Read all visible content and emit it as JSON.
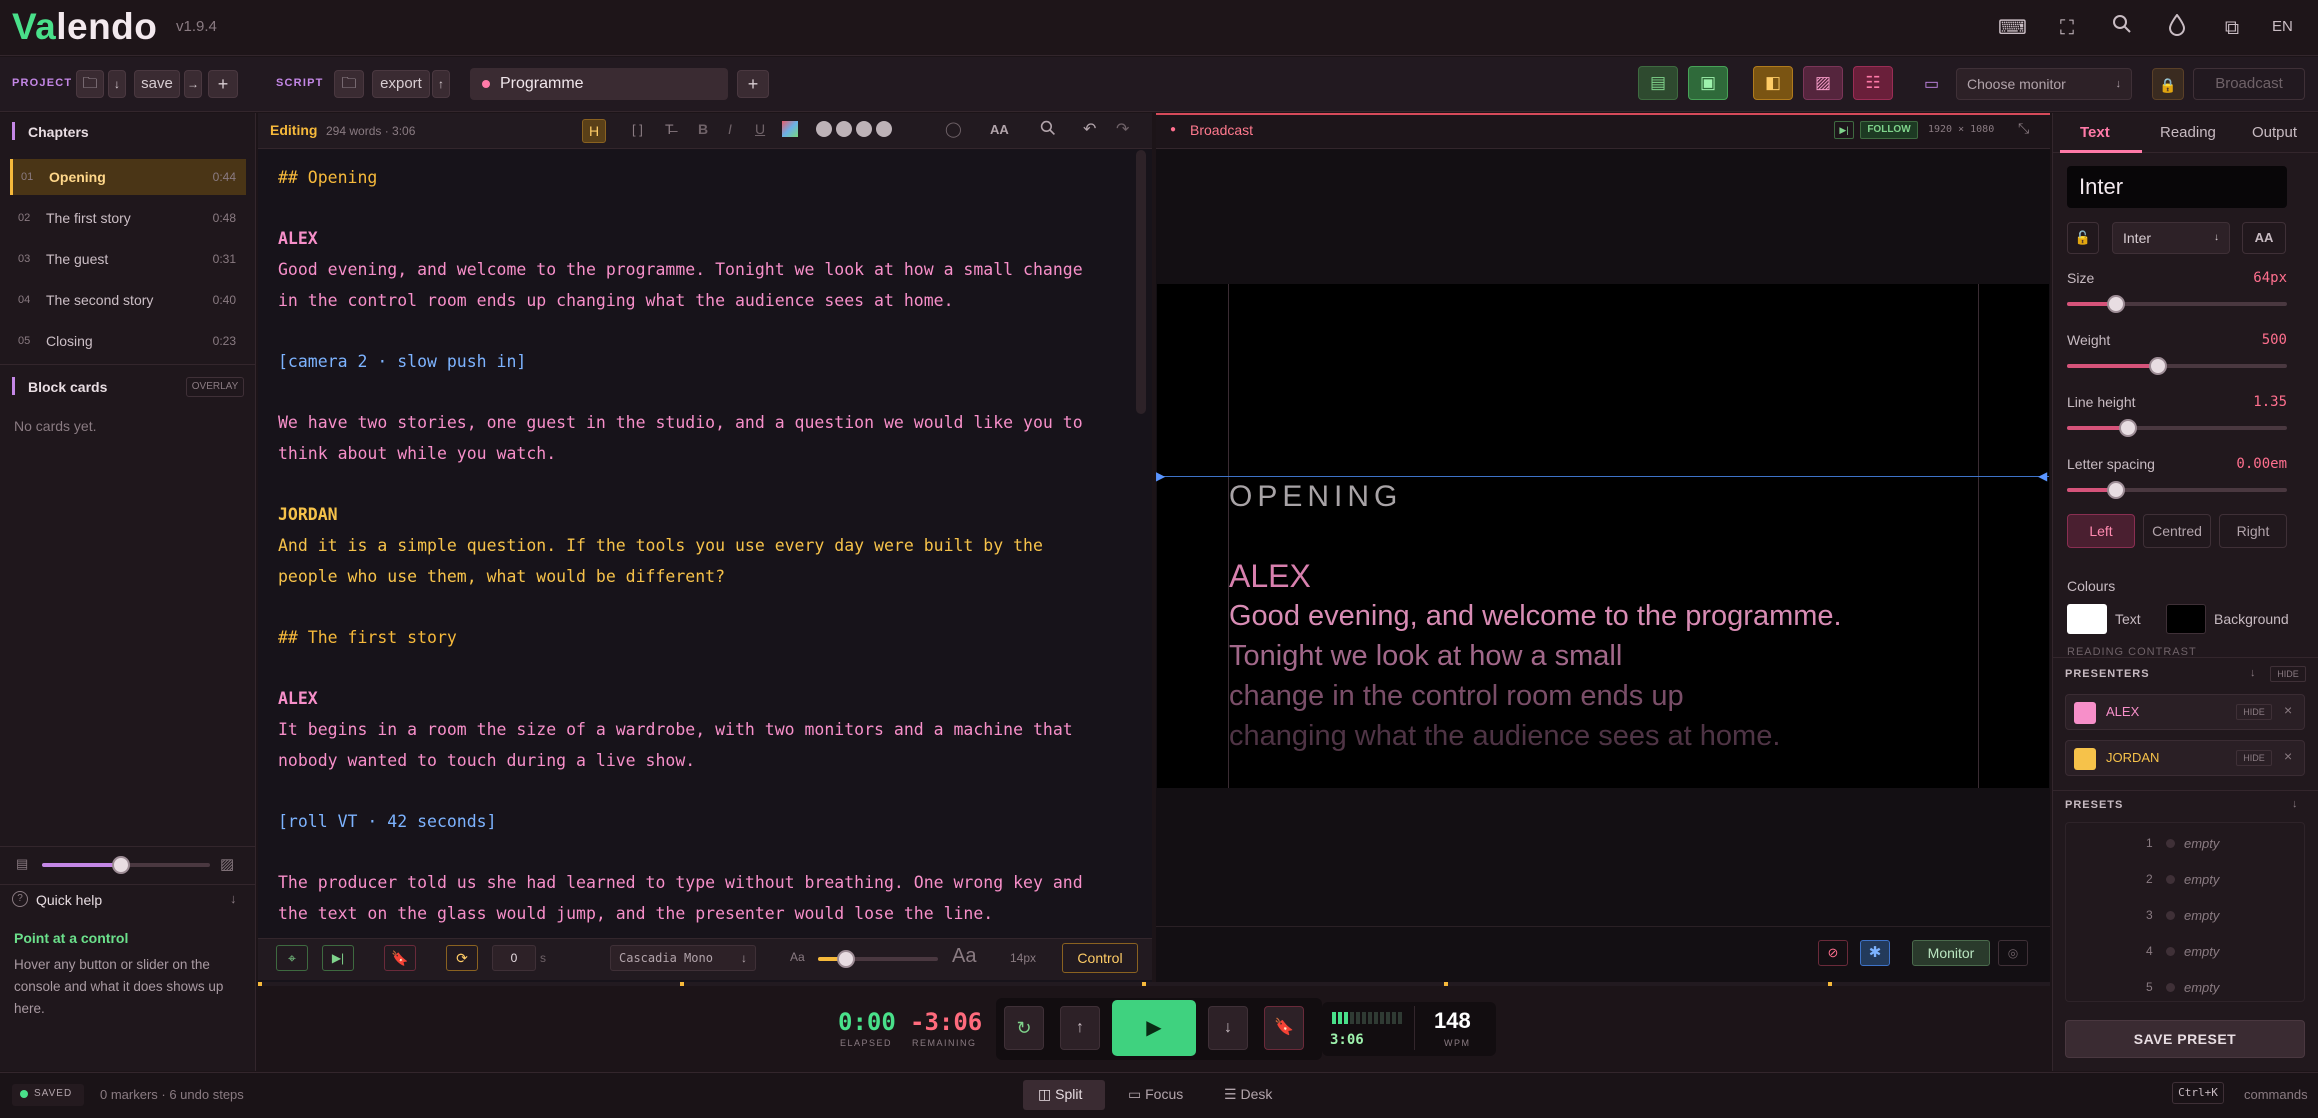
{
  "app": {
    "name_part1": "Va",
    "name_part2": "lendo",
    "version": "v1.9.4",
    "lang": "EN"
  },
  "toolbar": {
    "project_label": "PROJECT",
    "save": "save",
    "script_label": "SCRIPT",
    "export": "export",
    "programme": "Programme",
    "monitor_placeholder": "Choose monitor",
    "broadcast": "Broadcast"
  },
  "chapters": {
    "title": "Chapters",
    "items": [
      {
        "num": "01",
        "name": "Opening",
        "time": "0:44"
      },
      {
        "num": "02",
        "name": "The first story",
        "time": "0:48"
      },
      {
        "num": "03",
        "name": "The guest",
        "time": "0:31"
      },
      {
        "num": "04",
        "name": "The second story",
        "time": "0:40"
      },
      {
        "num": "05",
        "name": "Closing",
        "time": "0:23"
      }
    ]
  },
  "blockcards": {
    "title": "Block cards",
    "badge": "OVERLAY",
    "empty": "No cards yet."
  },
  "quickhelp": {
    "title": "Quick help",
    "heading": "Point at a control",
    "body": "Hover any button or slider on the console and what it does shows up here.",
    "slider_level": 0.47
  },
  "editor": {
    "mode": "Editing",
    "meta": "294 words · 3:06",
    "lines": [
      {
        "t": "## Opening",
        "c": "c-hd"
      },
      {
        "t": "ALEX",
        "c": "c-alex",
        "b": true
      },
      {
        "t": "Good evening, and welcome to the programme. Tonight we look at how a small change",
        "c": "c-alex"
      },
      {
        "t": "in the control room ends up changing what the audience sees at home.",
        "c": "c-alex"
      },
      {
        "t": "[camera 2 · slow push in]",
        "c": "c-cue"
      },
      {
        "t": "We have two stories, one guest in the studio, and a question we would like you to",
        "c": "c-alex"
      },
      {
        "t": "think about while you watch.",
        "c": "c-alex"
      },
      {
        "t": "JORDAN",
        "c": "c-jor",
        "b": true
      },
      {
        "t": "And it is a simple question. If the tools you use every day were built by the",
        "c": "c-jor"
      },
      {
        "t": "people who use them, what would be different?",
        "c": "c-jor"
      },
      {
        "t": "## The first story",
        "c": "c-hd"
      },
      {
        "t": "ALEX",
        "c": "c-alex",
        "b": true
      },
      {
        "t": "It begins in a room the size of a wardrobe, with two monitors and a machine that",
        "c": "c-alex"
      },
      {
        "t": "nobody wanted to touch during a live show.",
        "c": "c-alex"
      },
      {
        "t": "[roll VT · 42 seconds]",
        "c": "c-cue"
      },
      {
        "t": "The producer told us she had learned to type without breathing. One wrong key and",
        "c": "c-alex"
      },
      {
        "t": "the text on the glass would jump, and the presenter would lose the line.",
        "c": "c-alex"
      }
    ],
    "footer": {
      "offset": "0",
      "unit": "s",
      "font": "Cascadia Mono",
      "aa_small": "Aa",
      "aa_big": "Aa",
      "size": "14px",
      "control": "Control",
      "size_level": 0.23
    }
  },
  "broadcast": {
    "title": "Broadcast",
    "follow": "FOLLOW",
    "res": "1920 × 1080",
    "heading": "OPENING",
    "speaker": "ALEX",
    "lines": [
      "Good evening, and welcome to the programme.",
      "Tonight we look at how a small",
      "change in the control room ends up",
      "changing what the audience sees at home."
    ],
    "monitor": "Monitor"
  },
  "right": {
    "tabs": [
      "Text",
      "Reading",
      "Output"
    ],
    "font_display": "Inter",
    "font_select": "Inter",
    "aa": "AA",
    "size_label": "Size",
    "size_val": "64px",
    "weight_label": "Weight",
    "weight_val": "500",
    "lh_label": "Line height",
    "lh_val": "1.35",
    "ls_label": "Letter spacing",
    "ls_val": "0.00em",
    "align": [
      "Left",
      "Centred",
      "Right"
    ],
    "colours_label": "Colours",
    "text_label": "Text",
    "bg_label": "Background",
    "contrast": "READING CONTRAST",
    "presenters_label": "PRESENTERS",
    "hide": "HIDE",
    "presenters": [
      {
        "name": "ALEX",
        "color": "#f78fc9"
      },
      {
        "name": "JORDAN",
        "color": "#f6c24a"
      }
    ],
    "presets_label": "PRESETS",
    "presets": [
      {
        "n": "1",
        "v": "empty"
      },
      {
        "n": "2",
        "v": "empty"
      },
      {
        "n": "3",
        "v": "empty"
      },
      {
        "n": "4",
        "v": "empty"
      },
      {
        "n": "5",
        "v": "empty"
      }
    ],
    "save_preset": "SAVE PRESET"
  },
  "transport": {
    "elapsed": "0:00",
    "elapsed_label": "ELAPSED",
    "remaining": "-3:06",
    "remaining_label": "REMAINING",
    "time": "3:06",
    "wpm": "148",
    "wpm_label": "WPM"
  },
  "status": {
    "saved": "SAVED",
    "info": "0 markers · 6 undo steps",
    "views": [
      "Split",
      "Focus",
      "Desk"
    ],
    "shortcut": "Ctrl+K",
    "commands": "commands"
  }
}
